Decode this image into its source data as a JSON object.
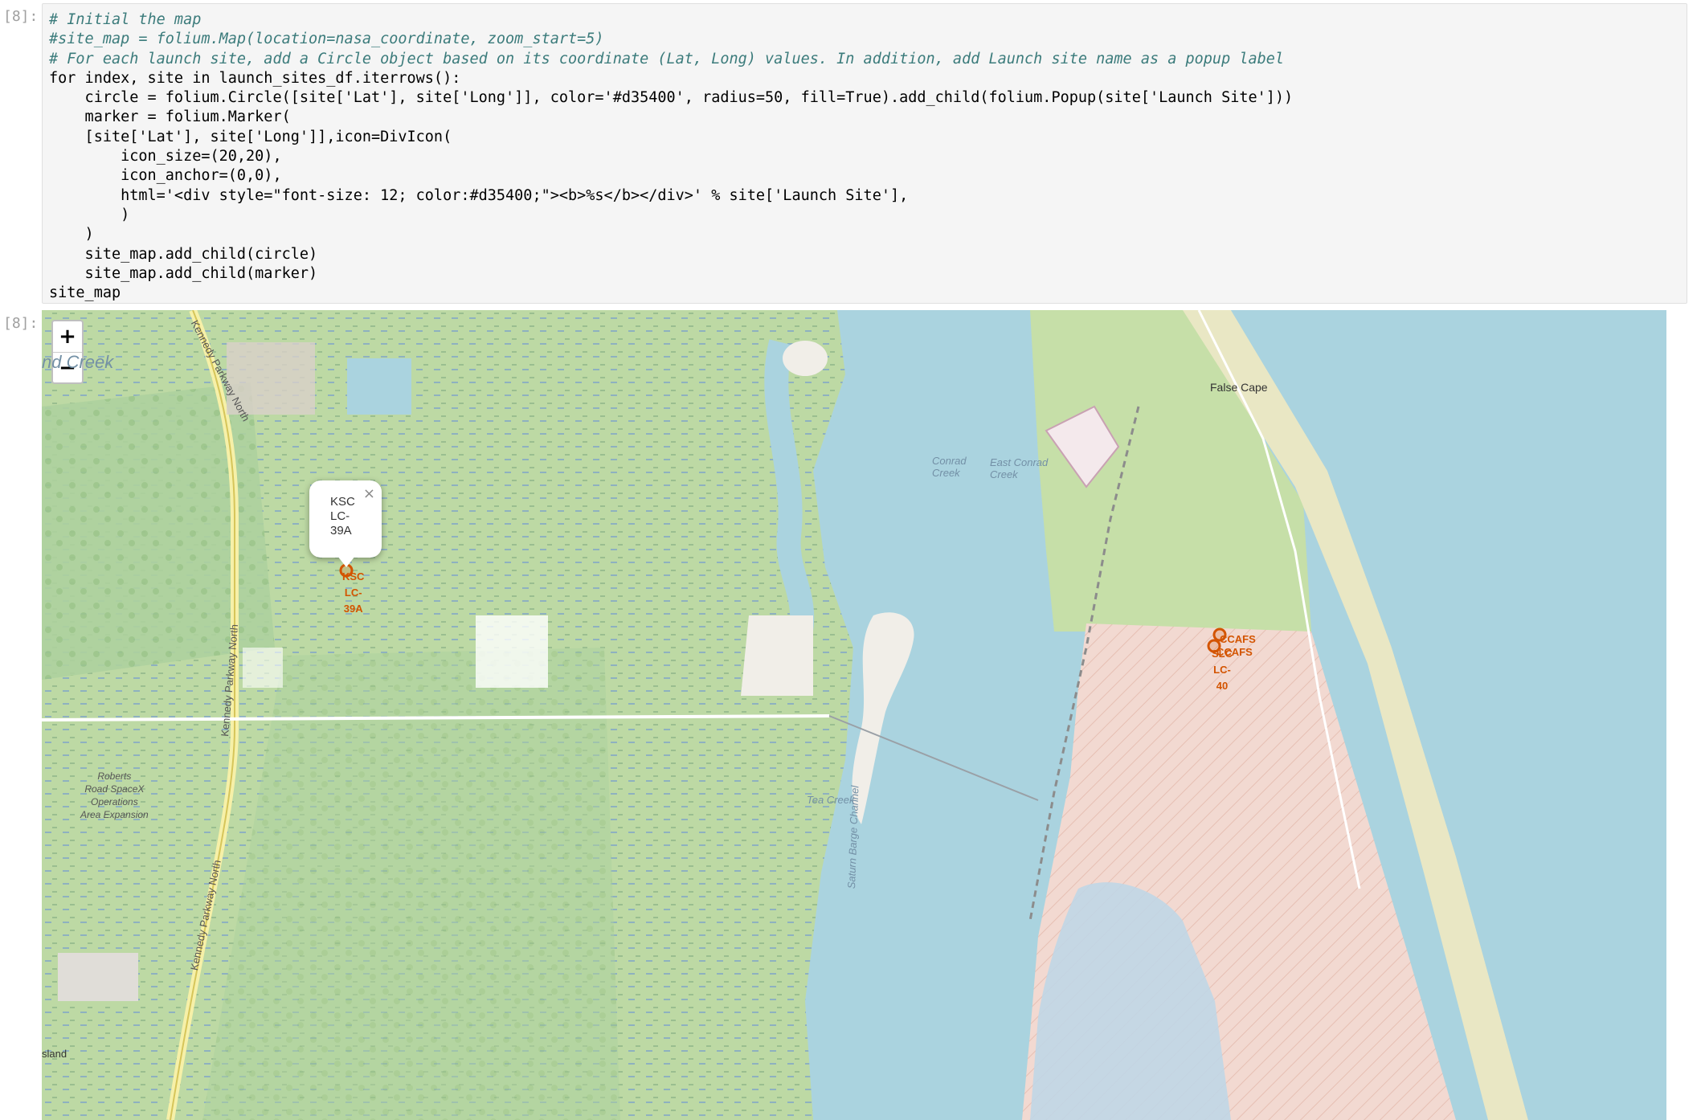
{
  "cells": {
    "input_prompt": "[8]:",
    "output_prompt": "[8]:"
  },
  "code": {
    "line1": "# Initial the map",
    "line2": "#site_map = folium.Map(location=nasa_coordinate, zoom_start=5)",
    "line3": "# For each launch site, add a Circle object based on its coordinate (Lat, Long) values. In addition, add Launch site name as a popup label",
    "line4": "for index, site in launch_sites_df.iterrows():",
    "line5": "    circle = folium.Circle([site['Lat'], site['Long']], color='#d35400', radius=50, fill=True).add_child(folium.Popup(site['Launch Site']))",
    "line6": "    marker = folium.Marker(",
    "line7": "    [site['Lat'], site['Long']],icon=DivIcon(",
    "line8": "        icon_size=(20,20),",
    "line9": "        icon_anchor=(0,0),",
    "line10": "        html='<div style=\"font-size: 12; color:#d35400;\"><b>%s</b></div>' % site['Launch Site'],",
    "line11": "        )",
    "line12": "    )",
    "line13": "    site_map.add_child(circle)",
    "line14": "    site_map.add_child(marker)",
    "line15": "site_map"
  },
  "map": {
    "zoom_in": "+",
    "zoom_out": "−",
    "labels": {
      "creek": "nd Creek",
      "false_cape": "False Cape",
      "conrad_creek": "Conrad\nCreek",
      "east_conrad_creek": "East Conrad\nCreek",
      "tea_creek": "Tea Creek",
      "saturn_barge": "Saturn Barge Channel",
      "kennedy_top": "Kennedy Parkway North",
      "kennedy_mid": "Kennedy Parkway North",
      "kennedy_low": "Kennedy Parkway North",
      "roberts": "Roberts\nRoad SpaceX\nOperations\nArea Expansion",
      "island": "sland"
    },
    "markers": [
      {
        "label": "KSC\nLC-\n39A"
      },
      {
        "label": "CCAFS"
      },
      {
        "label": "CCAFS"
      },
      {
        "label": "SLC\nLC-\n40"
      }
    ],
    "popup": {
      "text": "KSC\nLC-\n39A",
      "close": "×"
    },
    "colors": {
      "water": "#aad3df",
      "land": "#c6dfa8",
      "restricted": "#f2d9d1",
      "marker": "#d35400"
    }
  }
}
